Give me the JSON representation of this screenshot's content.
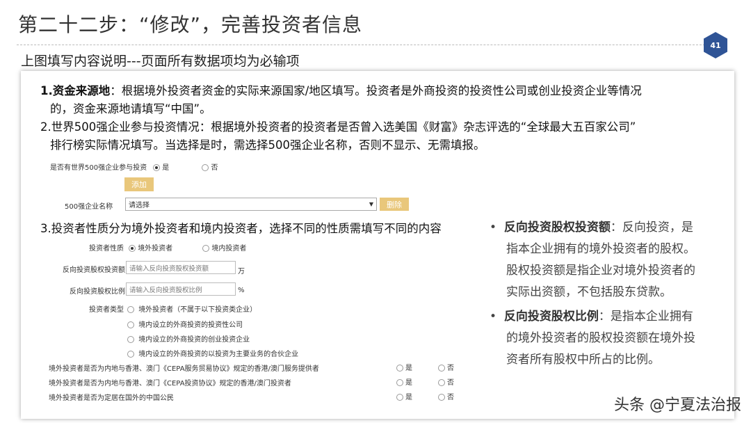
{
  "header": {
    "title": "第二十二步：“修改”，完善投资者信息",
    "page_number": "41",
    "subtitle": "上图填写内容说明---页面所有数据项均为必输项"
  },
  "instructions": {
    "item1_label": "1.资金来源地",
    "item1_line1": "：根据境外投资者资金的实际来源国家/地区填写。投资者是外商投资的投资性公司或创业投资企业等情况",
    "item1_line2": "的，资金来源地请填写“中国”。",
    "item2_line1": "2.世界500强企业参与投资情况：根据境外投资者的投资者是否曾入选美国《财富》杂志评选的“全球最大五百家公司”",
    "item2_line2": "排行榜实际情况填写。当选择是时，需选择500强企业名称，否则不显示、无需填报。",
    "item3_line1": "3.投资者性质分为境外投资者和境内投资者，选择不同的性质需填写不同的内容"
  },
  "form500": {
    "question": "是否有世界500强企业参与投资",
    "yes": "是",
    "no": "否",
    "add_button": "添加",
    "name_label": "500强企业名称",
    "select_value": "请选择",
    "delete_button": "删除"
  },
  "investor_form": {
    "nature_label": "投资者性质",
    "nature_foreign": "境外投资者",
    "nature_domestic": "境内投资者",
    "reverse_amount_label": "反向投资股权投资额",
    "reverse_amount_placeholder": "请输入反向投资股权投资额",
    "reverse_amount_unit": "万",
    "reverse_ratio_label": "反向投资股权比例",
    "reverse_ratio_placeholder": "请输入反向投资股权比例",
    "reverse_ratio_unit": "%",
    "type_label": "投资者类型",
    "type_options": [
      "境外投资者（不属于以下投资类企业）",
      "境内设立的外商投资的投资性公司",
      "境内设立的外商投资的创业投资企业",
      "境内设立的外商投资的以投资为主要业务的合伙企业"
    ],
    "questions": [
      "境外投资者是否为内地与香港、澳门《CEPA服务贸易协议》规定的香港/澳门服务提供者",
      "境外投资者是否为内地与香港、澳门《CEPA投资协议》规定的香港/澳门投资者",
      "境外投资者是否为定居在国外的中国公民"
    ],
    "yes": "是",
    "no": "否"
  },
  "notes": {
    "b1_term": "反向投资股权投资额",
    "b1_line1": "：反向投资，是",
    "b1_line2": "指本企业拥有的境外投资者的股权。",
    "b1_line3": "股权投资额是指企业对境外投资者的",
    "b1_line4": "实际出资额，不包括股东贷款。",
    "b2_term": "反向投资股权比例",
    "b2_line1": "：是指本企业拥有",
    "b2_line2": "的境外投资者的股权投资额在境外投",
    "b2_line3": "资者所有股权中所占的比例。"
  },
  "watermark": "头条 @宁夏法治报",
  "colors": {
    "accent": "#e9c77b",
    "badge": "#2f5496"
  }
}
